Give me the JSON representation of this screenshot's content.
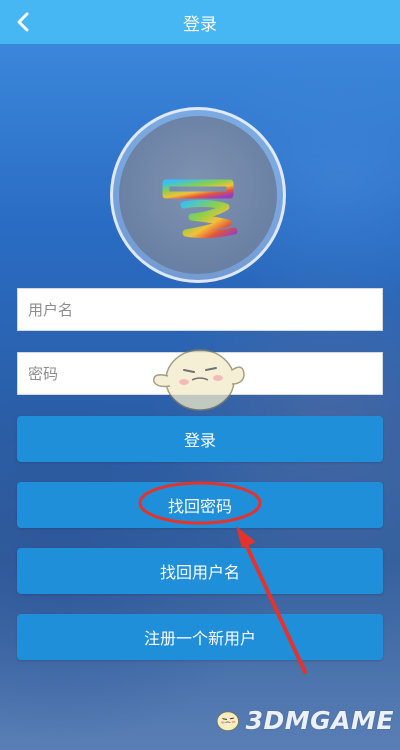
{
  "header": {
    "title": "登录",
    "back_icon": "chevron-left-icon"
  },
  "logo": {
    "icon": "app-logo-icon"
  },
  "form": {
    "username_placeholder": "用户名",
    "password_placeholder": "密码"
  },
  "buttons": {
    "login": "登录",
    "find_password": "找回密码",
    "find_username": "找回用户名",
    "register": "注册一个新用户"
  },
  "annotation": {
    "color": "#e5322d",
    "target": "find_password"
  },
  "watermark": {
    "text": "3DMGAME",
    "icon": "mascot-icon"
  },
  "colors": {
    "header": "#46b7f2",
    "button": "#1f8fda",
    "field_bg": "#ffffff"
  }
}
